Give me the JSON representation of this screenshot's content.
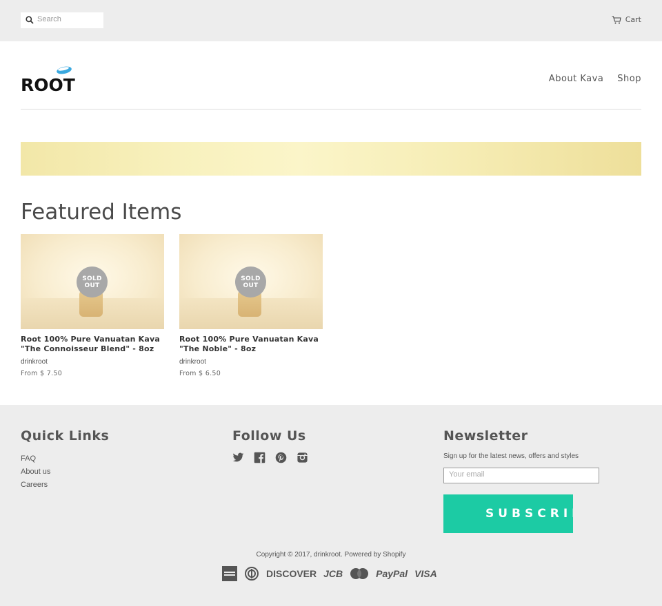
{
  "topbar": {
    "search_placeholder": "Search",
    "cart_label": "Cart"
  },
  "header": {
    "logo_text": "ROOT",
    "nav": [
      "About Kava",
      "Shop"
    ]
  },
  "main": {
    "featured_title": "Featured Items",
    "products": [
      {
        "title": "Root 100% Pure Vanuatan Kava \"The Connoisseur Blend\" - 8oz",
        "badge_line1": "SOLD",
        "badge_line2": "OUT",
        "vendor": "drinkroot",
        "price": "From $ 7.50"
      },
      {
        "title": "Root 100% Pure Vanuatan Kava \"The Noble\" - 8oz",
        "badge_line1": "SOLD",
        "badge_line2": "OUT",
        "vendor": "drinkroot",
        "price": "From $ 6.50"
      }
    ]
  },
  "footer": {
    "quick_links_title": "Quick Links",
    "quick_links": [
      "FAQ",
      "About us",
      "Careers"
    ],
    "follow_title": "Follow Us",
    "social_icons": [
      "twitter-icon",
      "facebook-icon",
      "pinterest-icon",
      "instagram-icon"
    ],
    "newsletter_title": "Newsletter",
    "newsletter_text": "Sign up for the latest news, offers and styles",
    "email_placeholder": "Your email",
    "subscribe_label": "SUBSCRIBE",
    "copyright": "Copyright © 2017, drinkroot. Powered by Shopify",
    "payments": {
      "discover": "DISCOVER",
      "jcb": "JCB",
      "paypal": "PayPal",
      "visa": "VISA",
      "icons": [
        "amex-icon",
        "diners-icon",
        "discover-icon",
        "jcb-icon",
        "mastercard-icon",
        "paypal-icon",
        "visa-icon"
      ]
    }
  },
  "colors": {
    "accent": "#1ccba4",
    "logo_blue": "#3aa9e0",
    "topbar_bg": "#ededed",
    "badge": "#a8a8a8"
  }
}
